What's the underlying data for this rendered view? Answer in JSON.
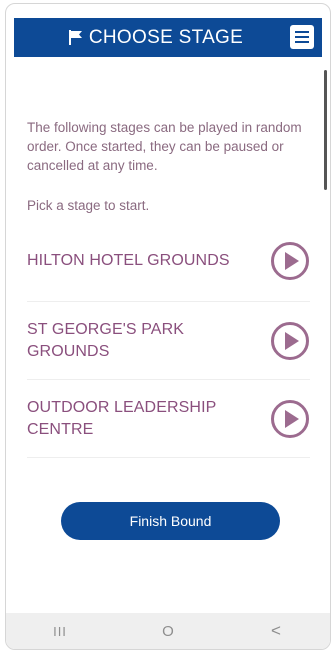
{
  "header": {
    "title": "CHOOSE STAGE",
    "flag_icon": "flag-icon",
    "menu_icon": "hamburger-menu-icon"
  },
  "intro_text": "The following stages can be played in random order. Once started, they can be paused or cancelled at any time.",
  "pick_text": "Pick a stage to start.",
  "stages": [
    {
      "label": "HILTON HOTEL GROUNDS",
      "icon": "play-icon"
    },
    {
      "label": "ST GEORGE'S PARK GROUNDS",
      "icon": "play-icon"
    },
    {
      "label": "OUTDOOR LEADERSHIP CENTRE",
      "icon": "play-icon"
    }
  ],
  "finish_button": "Finish Bound",
  "nav": {
    "recents": "III",
    "home": "O",
    "back": "<"
  },
  "colors": {
    "primary": "#0d4a96",
    "stage_text": "#8a4f7d",
    "body_text": "#8a6a80",
    "play_icon": "#9c6b8f"
  }
}
